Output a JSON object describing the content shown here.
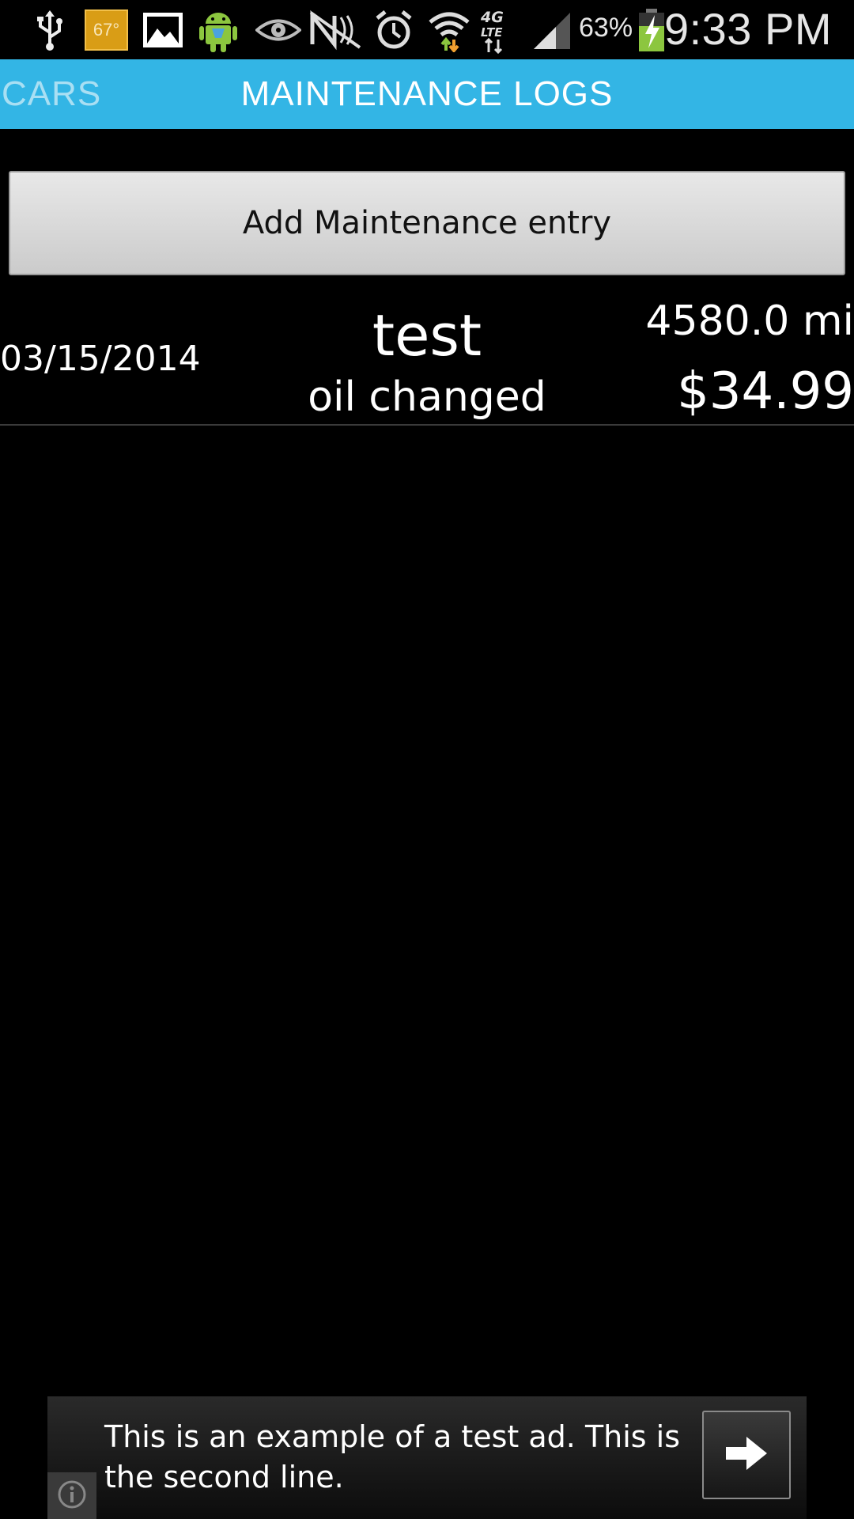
{
  "status_bar": {
    "temperature": "67°",
    "battery_percent": "63%",
    "time": "9:33 PM",
    "network": "4G LTE",
    "icons": [
      "usb-icon",
      "temperature-icon",
      "gallery-icon",
      "android-icon",
      "eye-icon",
      "nfc-off-icon",
      "alarm-icon",
      "wifi-icon",
      "lte-icon",
      "signal-icon",
      "battery-charging-icon"
    ]
  },
  "tabs": {
    "previous": "CARS",
    "current": "MAINTENANCE LOGS"
  },
  "add_button": {
    "label": "Add Maintenance entry"
  },
  "logs": [
    {
      "date": "03/15/2014",
      "title": "test",
      "description": "oil changed",
      "mileage": "4580.0 mi",
      "cost": "$34.99"
    }
  ],
  "ad": {
    "text": "This is an example of a test ad. This is the second line."
  },
  "colors": {
    "accent": "#33b5e5",
    "background": "#000000",
    "button": "#d6d6d6"
  }
}
